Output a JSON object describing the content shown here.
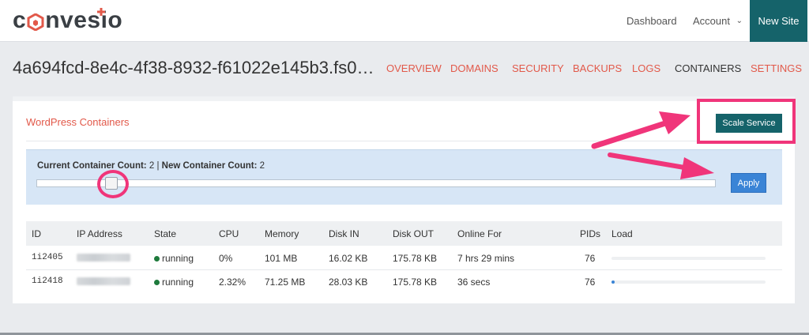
{
  "header": {
    "logo_text": [
      "c",
      "nvesio"
    ],
    "nav": {
      "dashboard": "Dashboard",
      "account": "Account",
      "account_caret": "⌄",
      "new_site": "New Site"
    }
  },
  "site": {
    "title": "4a694fcd-8e4c-4f38-8932-f61022e145b3.fs0…"
  },
  "tabs": [
    {
      "label": "OVERVIEW",
      "active": false
    },
    {
      "label": "DOMAINS",
      "active": false
    },
    {
      "label": "SECURITY",
      "active": false
    },
    {
      "label": "BACKUPS",
      "active": false
    },
    {
      "label": "LOGS",
      "active": false
    },
    {
      "label": "CONTAINERS",
      "active": true
    },
    {
      "label": "SETTINGS",
      "active": false
    }
  ],
  "panel": {
    "title": "WordPress Containers",
    "scale_button": "Scale Service"
  },
  "scaler": {
    "current_label": "Current Container Count:",
    "current_value": "2",
    "separator": "|",
    "new_label": "New Container Count:",
    "new_value": "2",
    "apply_button": "Apply",
    "slider_level": 0.11
  },
  "table": {
    "headers": [
      "ID",
      "IP Address",
      "State",
      "CPU",
      "Memory",
      "Disk IN",
      "Disk OUT",
      "Online For",
      "PIDs",
      "Load"
    ],
    "rows": [
      {
        "id": "1i2405",
        "state": "running",
        "cpu": "0%",
        "memory": "101 MB",
        "disk_in": "16.02 KB",
        "disk_out": "175.78 KB",
        "online_for": "7 hrs 29 mins",
        "pids": "76",
        "load": 0.0
      },
      {
        "id": "1i2418",
        "state": "running",
        "cpu": "2.32%",
        "memory": "71.25 MB",
        "disk_in": "28.03 KB",
        "disk_out": "175.78 KB",
        "online_for": "36 secs",
        "pids": "76",
        "load": 0.02
      }
    ]
  },
  "colors": {
    "brand_teal": "#15636a",
    "accent_red": "#e2594a",
    "apply_blue": "#3a84d6",
    "annotation_pink": "#f0357a",
    "running_green": "#1e7a3c"
  }
}
